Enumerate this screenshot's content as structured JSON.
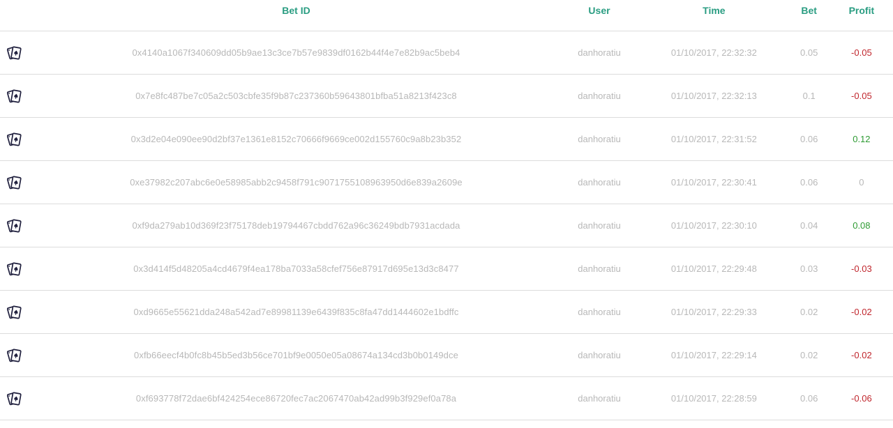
{
  "headers": {
    "bet_id": "Bet ID",
    "user": "User",
    "time": "Time",
    "bet": "Bet",
    "profit": "Profit"
  },
  "icon": "playing-cards-icon",
  "colors": {
    "header_accent": "#2a9d82",
    "negative": "#c0262d",
    "positive": "#2e9b33",
    "muted_text": "#b8b8b8",
    "icon": "#1f1f3d"
  },
  "rows": [
    {
      "bet_id": "0x4140a1067f340609dd05b9ae13c3ce7b57e9839df0162b44f4e7e82b9ac5beb4",
      "user": "danhoratiu",
      "time": "01/10/2017, 22:32:32",
      "bet": "0.05",
      "profit": "-0.05",
      "sign": "neg"
    },
    {
      "bet_id": "0x7e8fc487be7c05a2c503cbfe35f9b87c237360b59643801bfba51a8213f423c8",
      "user": "danhoratiu",
      "time": "01/10/2017, 22:32:13",
      "bet": "0.1",
      "profit": "-0.05",
      "sign": "neg"
    },
    {
      "bet_id": "0x3d2e04e090ee90d2bf37e1361e8152c70666f9669ce002d155760c9a8b23b352",
      "user": "danhoratiu",
      "time": "01/10/2017, 22:31:52",
      "bet": "0.06",
      "profit": "0.12",
      "sign": "pos"
    },
    {
      "bet_id": "0xe37982c207abc6e0e58985abb2c9458f791c9071755108963950d6e839a2609e",
      "user": "danhoratiu",
      "time": "01/10/2017, 22:30:41",
      "bet": "0.06",
      "profit": "0",
      "sign": "zero"
    },
    {
      "bet_id": "0xf9da279ab10d369f23f75178deb19794467cbdd762a96c36249bdb7931acdada",
      "user": "danhoratiu",
      "time": "01/10/2017, 22:30:10",
      "bet": "0.04",
      "profit": "0.08",
      "sign": "pos"
    },
    {
      "bet_id": "0x3d414f5d48205a4cd4679f4ea178ba7033a58cfef756e87917d695e13d3c8477",
      "user": "danhoratiu",
      "time": "01/10/2017, 22:29:48",
      "bet": "0.03",
      "profit": "-0.03",
      "sign": "neg"
    },
    {
      "bet_id": "0xd9665e55621dda248a542ad7e89981139e6439f835c8fa47dd1444602e1bdffc",
      "user": "danhoratiu",
      "time": "01/10/2017, 22:29:33",
      "bet": "0.02",
      "profit": "-0.02",
      "sign": "neg"
    },
    {
      "bet_id": "0xfb66eecf4b0fc8b45b5ed3b56ce701bf9e0050e05a08674a134cd3b0b0149dce",
      "user": "danhoratiu",
      "time": "01/10/2017, 22:29:14",
      "bet": "0.02",
      "profit": "-0.02",
      "sign": "neg"
    },
    {
      "bet_id": "0xf693778f72dae6bf424254ece86720fec7ac2067470ab42ad99b3f929ef0a78a",
      "user": "danhoratiu",
      "time": "01/10/2017, 22:28:59",
      "bet": "0.06",
      "profit": "-0.06",
      "sign": "neg"
    }
  ]
}
